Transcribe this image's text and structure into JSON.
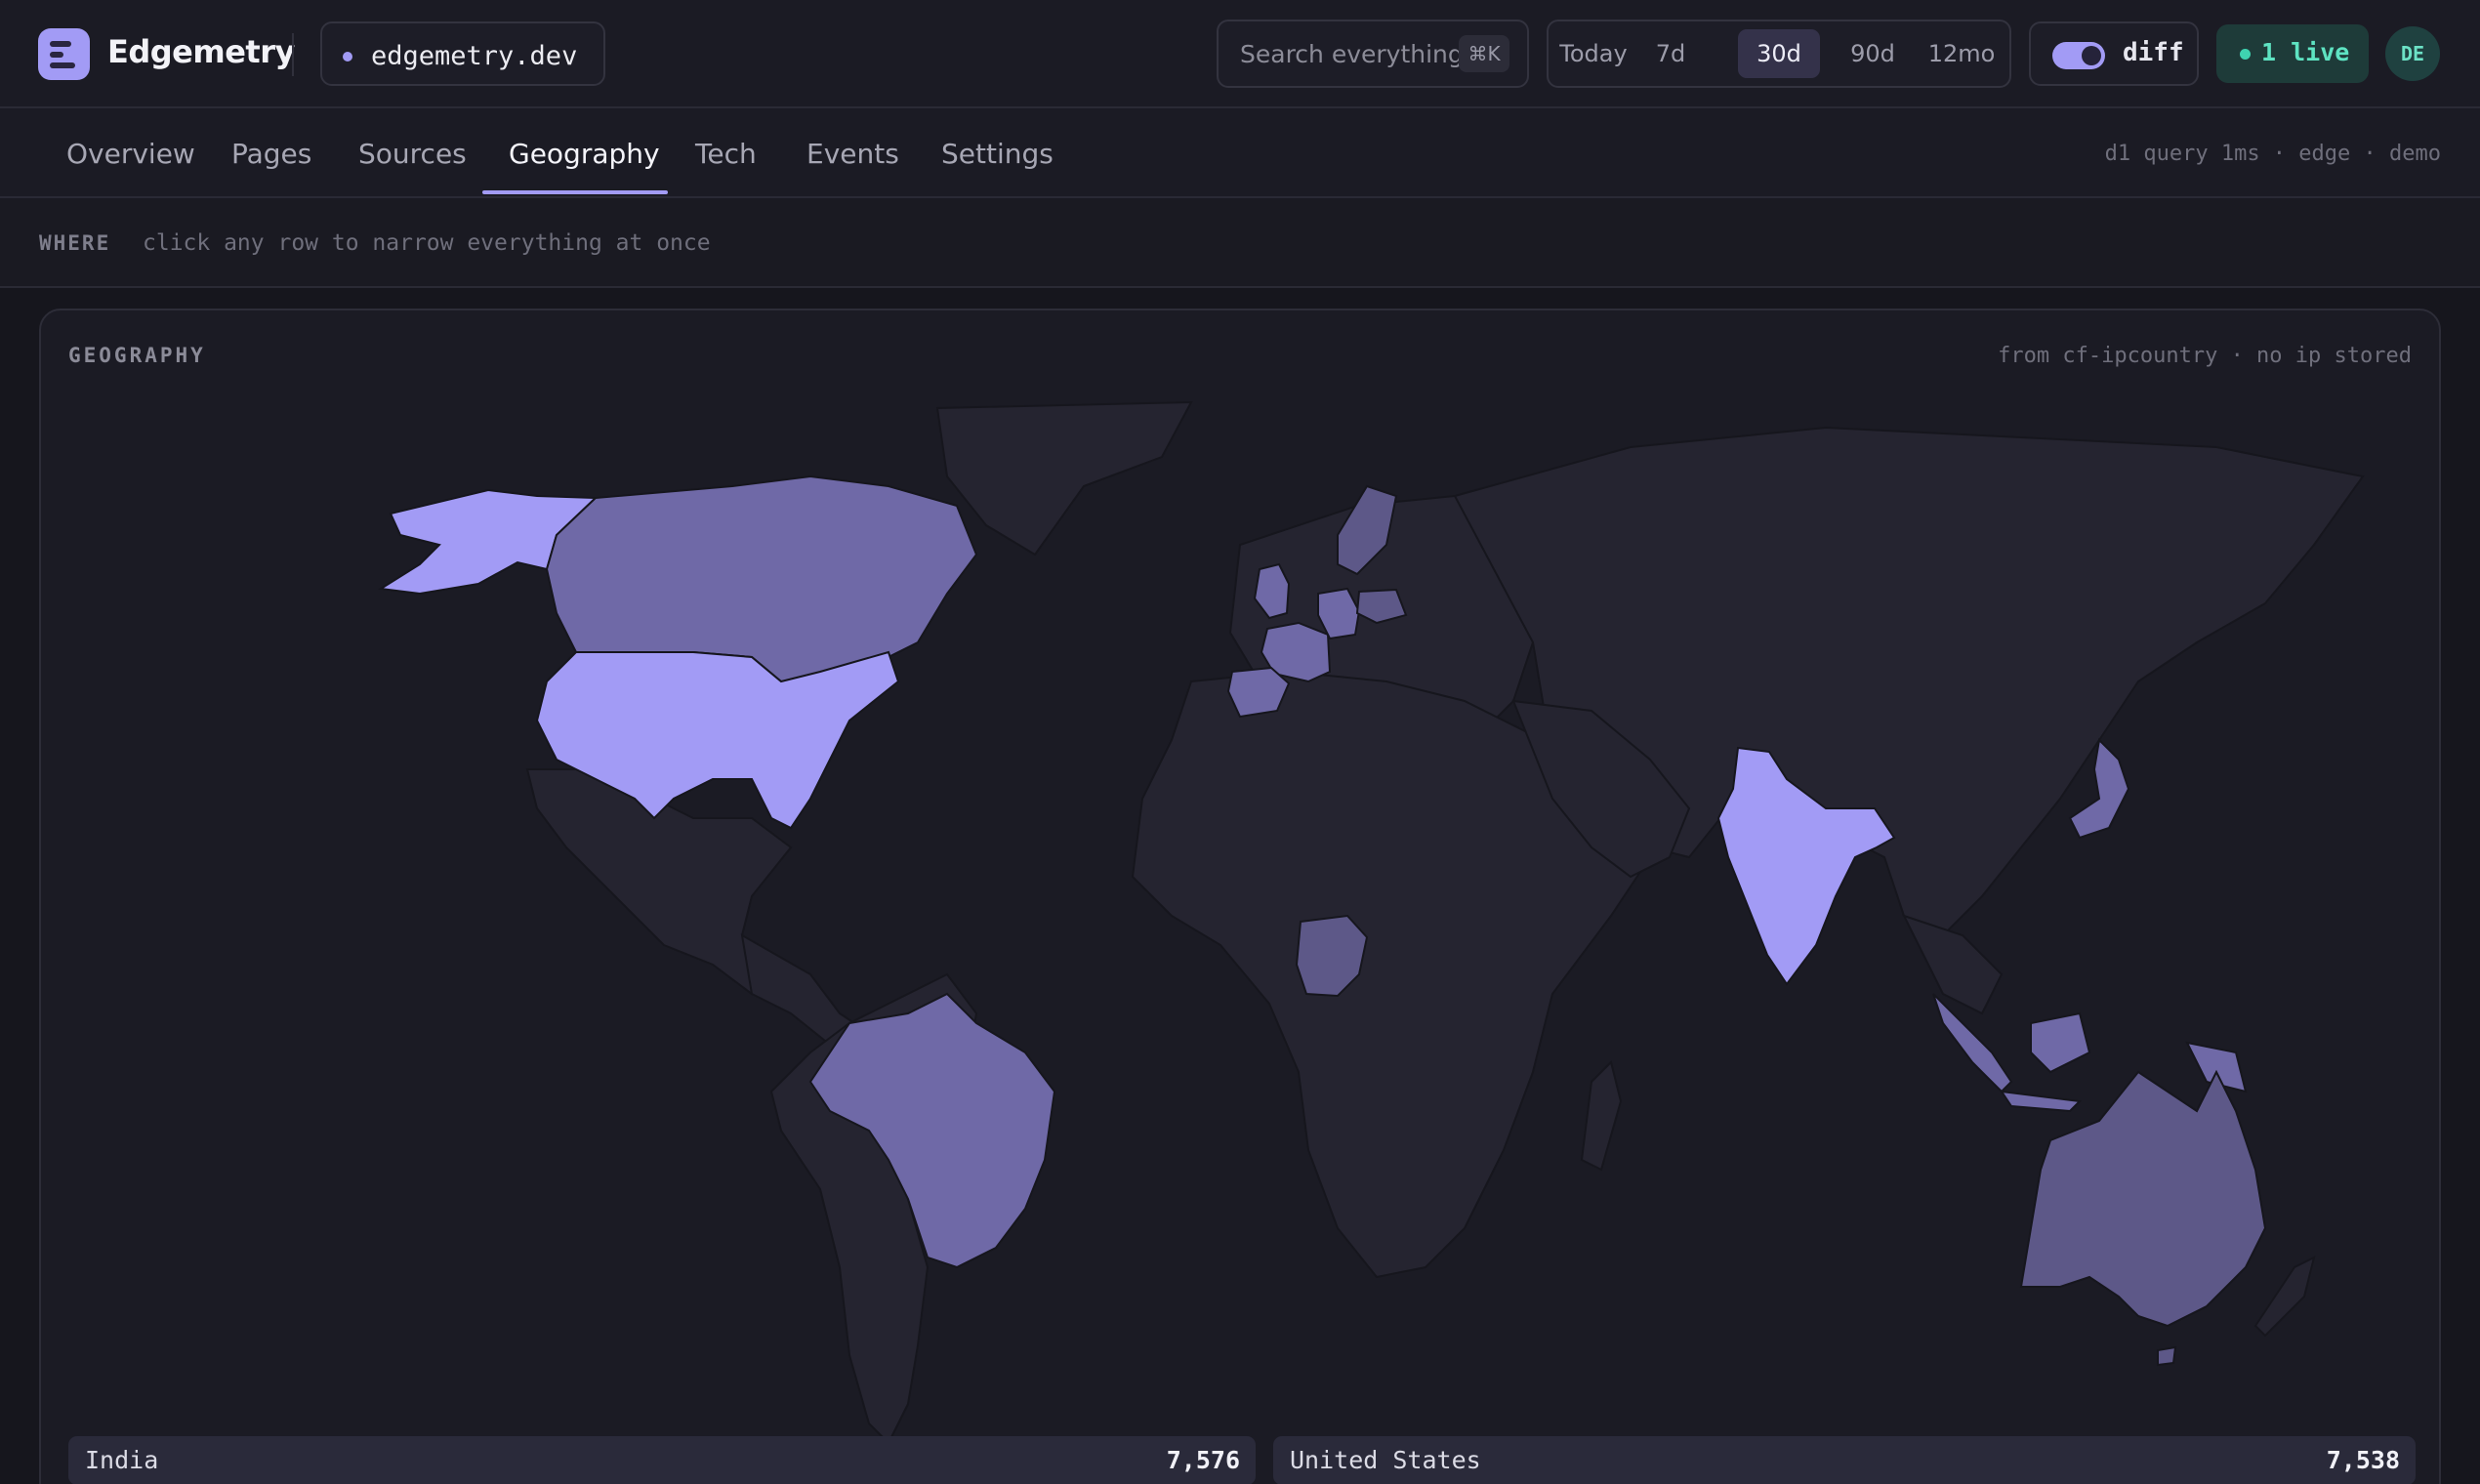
{
  "app": {
    "name": "Edgemetry",
    "site": "edgemetry.dev"
  },
  "header": {
    "search_placeholder": "Search everything",
    "search_shortcut": "⌘K",
    "ranges": [
      {
        "label": "Today",
        "active": false
      },
      {
        "label": "7d",
        "active": false
      },
      {
        "label": "30d",
        "active": true
      },
      {
        "label": "90d",
        "active": false
      },
      {
        "label": "12mo",
        "active": false
      }
    ],
    "diff_label": "diff",
    "diff_enabled": true,
    "live_label": "1 live",
    "avatar_initials": "DE"
  },
  "nav": {
    "tabs": [
      {
        "label": "Overview",
        "active": false
      },
      {
        "label": "Pages",
        "active": false
      },
      {
        "label": "Sources",
        "active": false
      },
      {
        "label": "Geography",
        "active": true
      },
      {
        "label": "Tech",
        "active": false
      },
      {
        "label": "Events",
        "active": false
      },
      {
        "label": "Settings",
        "active": false
      }
    ],
    "meta": "d1 query 1ms · edge · demo"
  },
  "filter": {
    "label": "WHERE",
    "hint": "click any row to narrow everything at once"
  },
  "geography": {
    "title": "GEOGRAPHY",
    "source_note": "from cf-ipcountry · no ip stored",
    "highlighted_countries": [
      {
        "name": "United States",
        "shade": "high"
      },
      {
        "name": "India",
        "shade": "high"
      },
      {
        "name": "Canada",
        "shade": "medium"
      },
      {
        "name": "Brazil",
        "shade": "medium"
      },
      {
        "name": "Australia",
        "shade": "medium"
      },
      {
        "name": "Nigeria",
        "shade": "medium"
      },
      {
        "name": "United Kingdom",
        "shade": "medium"
      },
      {
        "name": "Germany",
        "shade": "medium"
      },
      {
        "name": "France",
        "shade": "medium"
      },
      {
        "name": "Spain",
        "shade": "medium"
      },
      {
        "name": "Japan",
        "shade": "medium"
      },
      {
        "name": "Indonesia",
        "shade": "medium"
      }
    ],
    "rows": [
      {
        "country": "India",
        "value": "7,576"
      },
      {
        "country": "United States",
        "value": "7,538"
      }
    ]
  }
}
